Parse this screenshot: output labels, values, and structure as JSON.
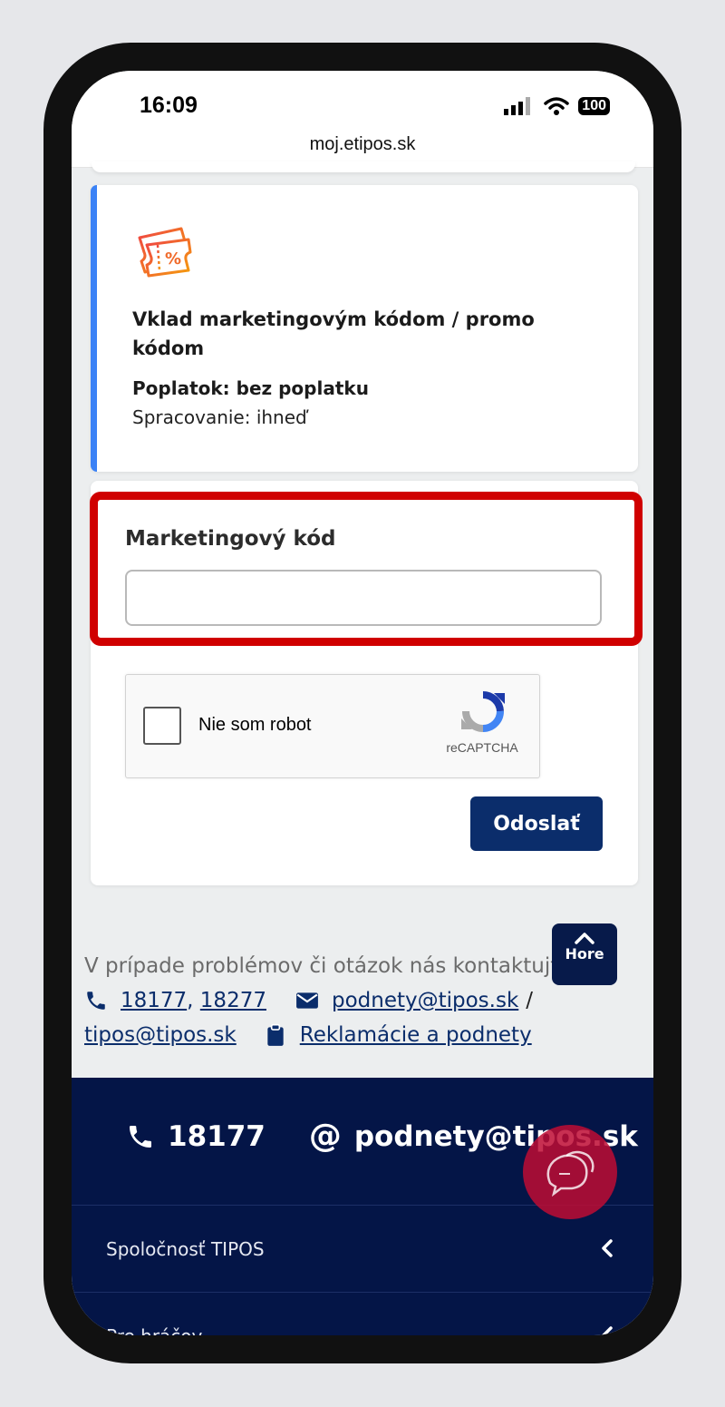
{
  "status": {
    "time": "16:09",
    "battery": "100"
  },
  "browser": {
    "url": "moj.etipos.sk"
  },
  "info_card": {
    "title": "Vklad marketingovým kódom / promo kódom",
    "fee": "Poplatok: bez poplatku",
    "processing": "Spracovanie: ihneď"
  },
  "form": {
    "label": "Marketingový kód",
    "input_value": "",
    "captcha_label": "Nie som robot",
    "captcha_brand": "reCAPTCHA",
    "submit": "Odoslať"
  },
  "contact": {
    "text": "V prípade problémov či otázok nás kontaktujte na:",
    "phone1": "18177",
    "phone2": "18277",
    "email1": " podnety@tipos.sk",
    "slash": "/",
    "email2": "tipos@tipos.sk",
    "complaints": "Reklamácie a podnety"
  },
  "back_to_top": "Hore",
  "footer": {
    "phone": "18177",
    "at": "@",
    "email": "podnety@tipos.sk",
    "items": [
      "Spoločnosť TIPOS",
      "Pre hráčov"
    ]
  },
  "colors": {
    "accent_blue": "#3b82f6",
    "navy": "#041547",
    "button": "#0b2d6b",
    "highlight": "#d00000"
  }
}
